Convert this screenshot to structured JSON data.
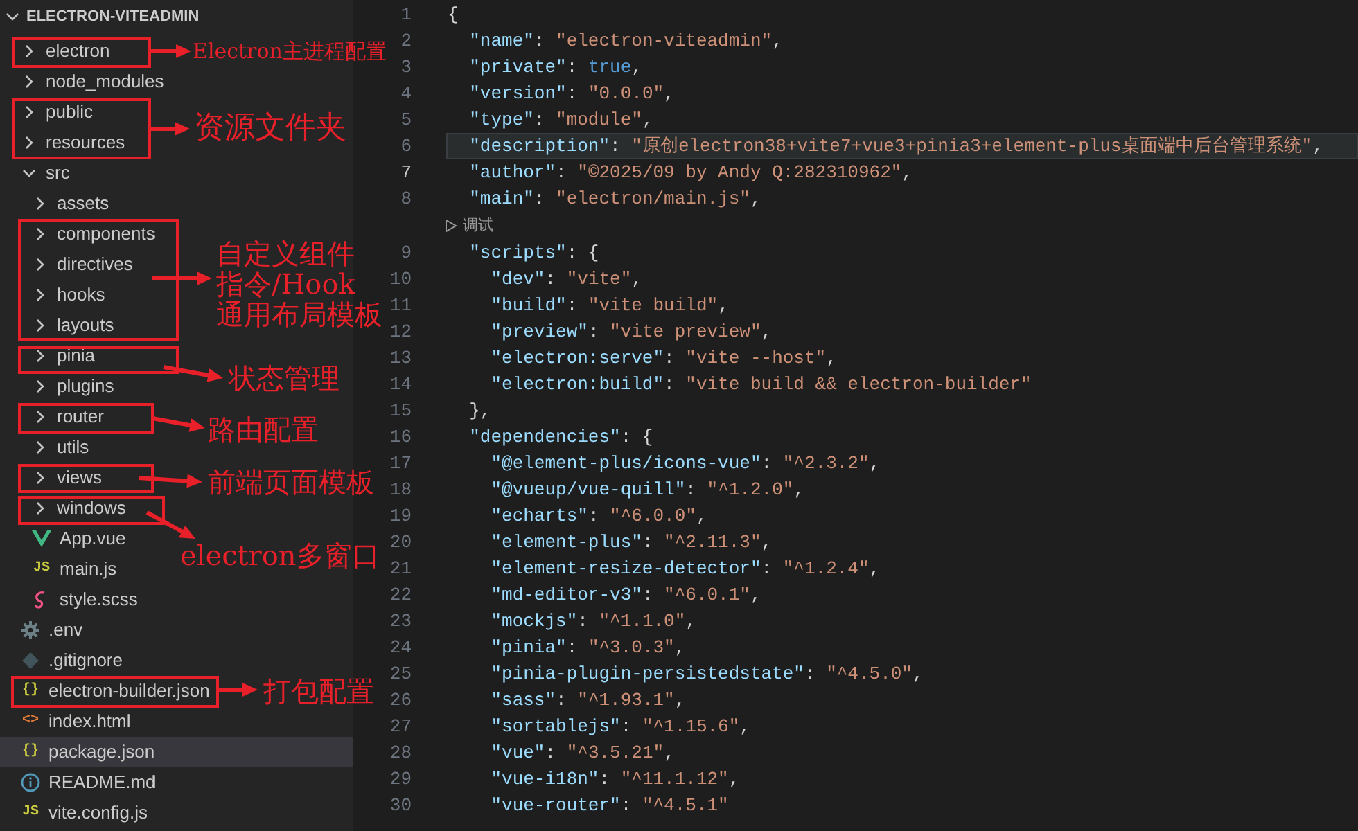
{
  "explorer": {
    "title": "ELECTRON-VITEADMIN",
    "expanded": true,
    "items": [
      {
        "name": "electron",
        "kind": "folder",
        "expanded": false,
        "selected": false
      },
      {
        "name": "node_modules",
        "kind": "folder",
        "expanded": false,
        "selected": false
      },
      {
        "name": "public",
        "kind": "folder",
        "expanded": false,
        "selected": false
      },
      {
        "name": "resources",
        "kind": "folder",
        "expanded": false,
        "selected": false
      },
      {
        "name": "src",
        "kind": "folder",
        "expanded": true,
        "selected": false,
        "children": [
          {
            "name": "assets",
            "kind": "folder",
            "expanded": false,
            "selected": false
          },
          {
            "name": "components",
            "kind": "folder",
            "expanded": false,
            "selected": false
          },
          {
            "name": "directives",
            "kind": "folder",
            "expanded": false,
            "selected": false
          },
          {
            "name": "hooks",
            "kind": "folder",
            "expanded": false,
            "selected": false
          },
          {
            "name": "layouts",
            "kind": "folder",
            "expanded": false,
            "selected": false
          },
          {
            "name": "pinia",
            "kind": "folder",
            "expanded": false,
            "selected": false
          },
          {
            "name": "plugins",
            "kind": "folder",
            "expanded": false,
            "selected": false
          },
          {
            "name": "router",
            "kind": "folder",
            "expanded": false,
            "selected": false
          },
          {
            "name": "utils",
            "kind": "folder",
            "expanded": false,
            "selected": false
          },
          {
            "name": "views",
            "kind": "folder",
            "expanded": false,
            "selected": false
          },
          {
            "name": "windows",
            "kind": "folder",
            "expanded": false,
            "selected": false
          },
          {
            "name": "App.vue",
            "kind": "vue",
            "selected": false
          },
          {
            "name": "main.js",
            "kind": "js",
            "badge": "JS",
            "selected": false
          },
          {
            "name": "style.scss",
            "kind": "scss",
            "selected": false
          }
        ]
      },
      {
        "name": ".env",
        "kind": "config",
        "selected": false
      },
      {
        "name": ".gitignore",
        "kind": "git",
        "selected": false
      },
      {
        "name": "electron-builder.json",
        "kind": "json",
        "badge": "{}",
        "selected": false
      },
      {
        "name": "index.html",
        "kind": "html",
        "badge": "<>",
        "selected": false
      },
      {
        "name": "package.json",
        "kind": "json",
        "badge": "{}",
        "selected": true
      },
      {
        "name": "README.md",
        "kind": "readme",
        "selected": false
      },
      {
        "name": "vite.config.js",
        "kind": "js",
        "badge": "JS",
        "selected": false
      }
    ]
  },
  "annotations": [
    {
      "lines": [
        "Electron主进程配置"
      ]
    },
    {
      "lines": [
        "资源文件夹"
      ]
    },
    {
      "lines": [
        "自定义组件",
        "指令/Hook",
        "通用布局模板"
      ]
    },
    {
      "lines": [
        "状态管理"
      ]
    },
    {
      "lines": [
        "路由配置"
      ]
    },
    {
      "lines": [
        "前端页面模板"
      ]
    },
    {
      "lines": [
        "electron多窗口"
      ]
    },
    {
      "lines": [
        "打包配置"
      ]
    }
  ],
  "editor": {
    "lines": [
      {
        "kind": "code",
        "n": "1",
        "text": "{",
        "current": false,
        "highlighted": false
      },
      {
        "kind": "code",
        "n": "2",
        "text": "  \"name\": \"electron-viteadmin\",",
        "current": false,
        "highlighted": false
      },
      {
        "kind": "code",
        "n": "3",
        "text": "  \"private\": true,",
        "current": false,
        "highlighted": false
      },
      {
        "kind": "code",
        "n": "4",
        "text": "  \"version\": \"0.0.0\",",
        "current": false,
        "highlighted": false
      },
      {
        "kind": "code",
        "n": "5",
        "text": "  \"type\": \"module\",",
        "current": false,
        "highlighted": false
      },
      {
        "kind": "code",
        "n": "6",
        "text": "  \"description\": \"原创electron38+vite7+vue3+pinia3+element-plus桌面端中后台管理系统\",",
        "current": false,
        "highlighted": true
      },
      {
        "kind": "code",
        "n": "7",
        "text": "  \"author\": \"©2025/09 by Andy Q:282310962\",",
        "current": true,
        "highlighted": false
      },
      {
        "kind": "code",
        "n": "8",
        "text": "  \"main\": \"electron/main.js\",",
        "current": false,
        "highlighted": false
      },
      {
        "kind": "codelens",
        "text": "调试"
      },
      {
        "kind": "code",
        "n": "9",
        "text": "  \"scripts\": {",
        "current": false,
        "highlighted": false
      },
      {
        "kind": "code",
        "n": "10",
        "text": "    \"dev\": \"vite\",",
        "current": false,
        "highlighted": false
      },
      {
        "kind": "code",
        "n": "11",
        "text": "    \"build\": \"vite build\",",
        "current": false,
        "highlighted": false
      },
      {
        "kind": "code",
        "n": "12",
        "text": "    \"preview\": \"vite preview\",",
        "current": false,
        "highlighted": false
      },
      {
        "kind": "code",
        "n": "13",
        "text": "    \"electron:serve\": \"vite --host\",",
        "current": false,
        "highlighted": false
      },
      {
        "kind": "code",
        "n": "14",
        "text": "    \"electron:build\": \"vite build && electron-builder\"",
        "current": false,
        "highlighted": false
      },
      {
        "kind": "code",
        "n": "15",
        "text": "  },",
        "current": false,
        "highlighted": false
      },
      {
        "kind": "code",
        "n": "16",
        "text": "  \"dependencies\": {",
        "current": false,
        "highlighted": false
      },
      {
        "kind": "code",
        "n": "17",
        "text": "    \"@element-plus/icons-vue\": \"^2.3.2\",",
        "current": false,
        "highlighted": false
      },
      {
        "kind": "code",
        "n": "18",
        "text": "    \"@vueup/vue-quill\": \"^1.2.0\",",
        "current": false,
        "highlighted": false
      },
      {
        "kind": "code",
        "n": "19",
        "text": "    \"echarts\": \"^6.0.0\",",
        "current": false,
        "highlighted": false
      },
      {
        "kind": "code",
        "n": "20",
        "text": "    \"element-plus\": \"^2.11.3\",",
        "current": false,
        "highlighted": false
      },
      {
        "kind": "code",
        "n": "21",
        "text": "    \"element-resize-detector\": \"^1.2.4\",",
        "current": false,
        "highlighted": false
      },
      {
        "kind": "code",
        "n": "22",
        "text": "    \"md-editor-v3\": \"^6.0.1\",",
        "current": false,
        "highlighted": false
      },
      {
        "kind": "code",
        "n": "23",
        "text": "    \"mockjs\": \"^1.1.0\",",
        "current": false,
        "highlighted": false
      },
      {
        "kind": "code",
        "n": "24",
        "text": "    \"pinia\": \"^3.0.3\",",
        "current": false,
        "highlighted": false
      },
      {
        "kind": "code",
        "n": "25",
        "text": "    \"pinia-plugin-persistedstate\": \"^4.5.0\",",
        "current": false,
        "highlighted": false
      },
      {
        "kind": "code",
        "n": "26",
        "text": "    \"sass\": \"^1.93.1\",",
        "current": false,
        "highlighted": false
      },
      {
        "kind": "code",
        "n": "27",
        "text": "    \"sortablejs\": \"^1.15.6\",",
        "current": false,
        "highlighted": false
      },
      {
        "kind": "code",
        "n": "28",
        "text": "    \"vue\": \"^3.5.21\",",
        "current": false,
        "highlighted": false
      },
      {
        "kind": "code",
        "n": "29",
        "text": "    \"vue-i18n\": \"^11.1.12\",",
        "current": false,
        "highlighted": false
      },
      {
        "kind": "code",
        "n": "30",
        "text": "    \"vue-router\": \"^4.5.1\"",
        "current": false,
        "highlighted": false
      }
    ]
  }
}
